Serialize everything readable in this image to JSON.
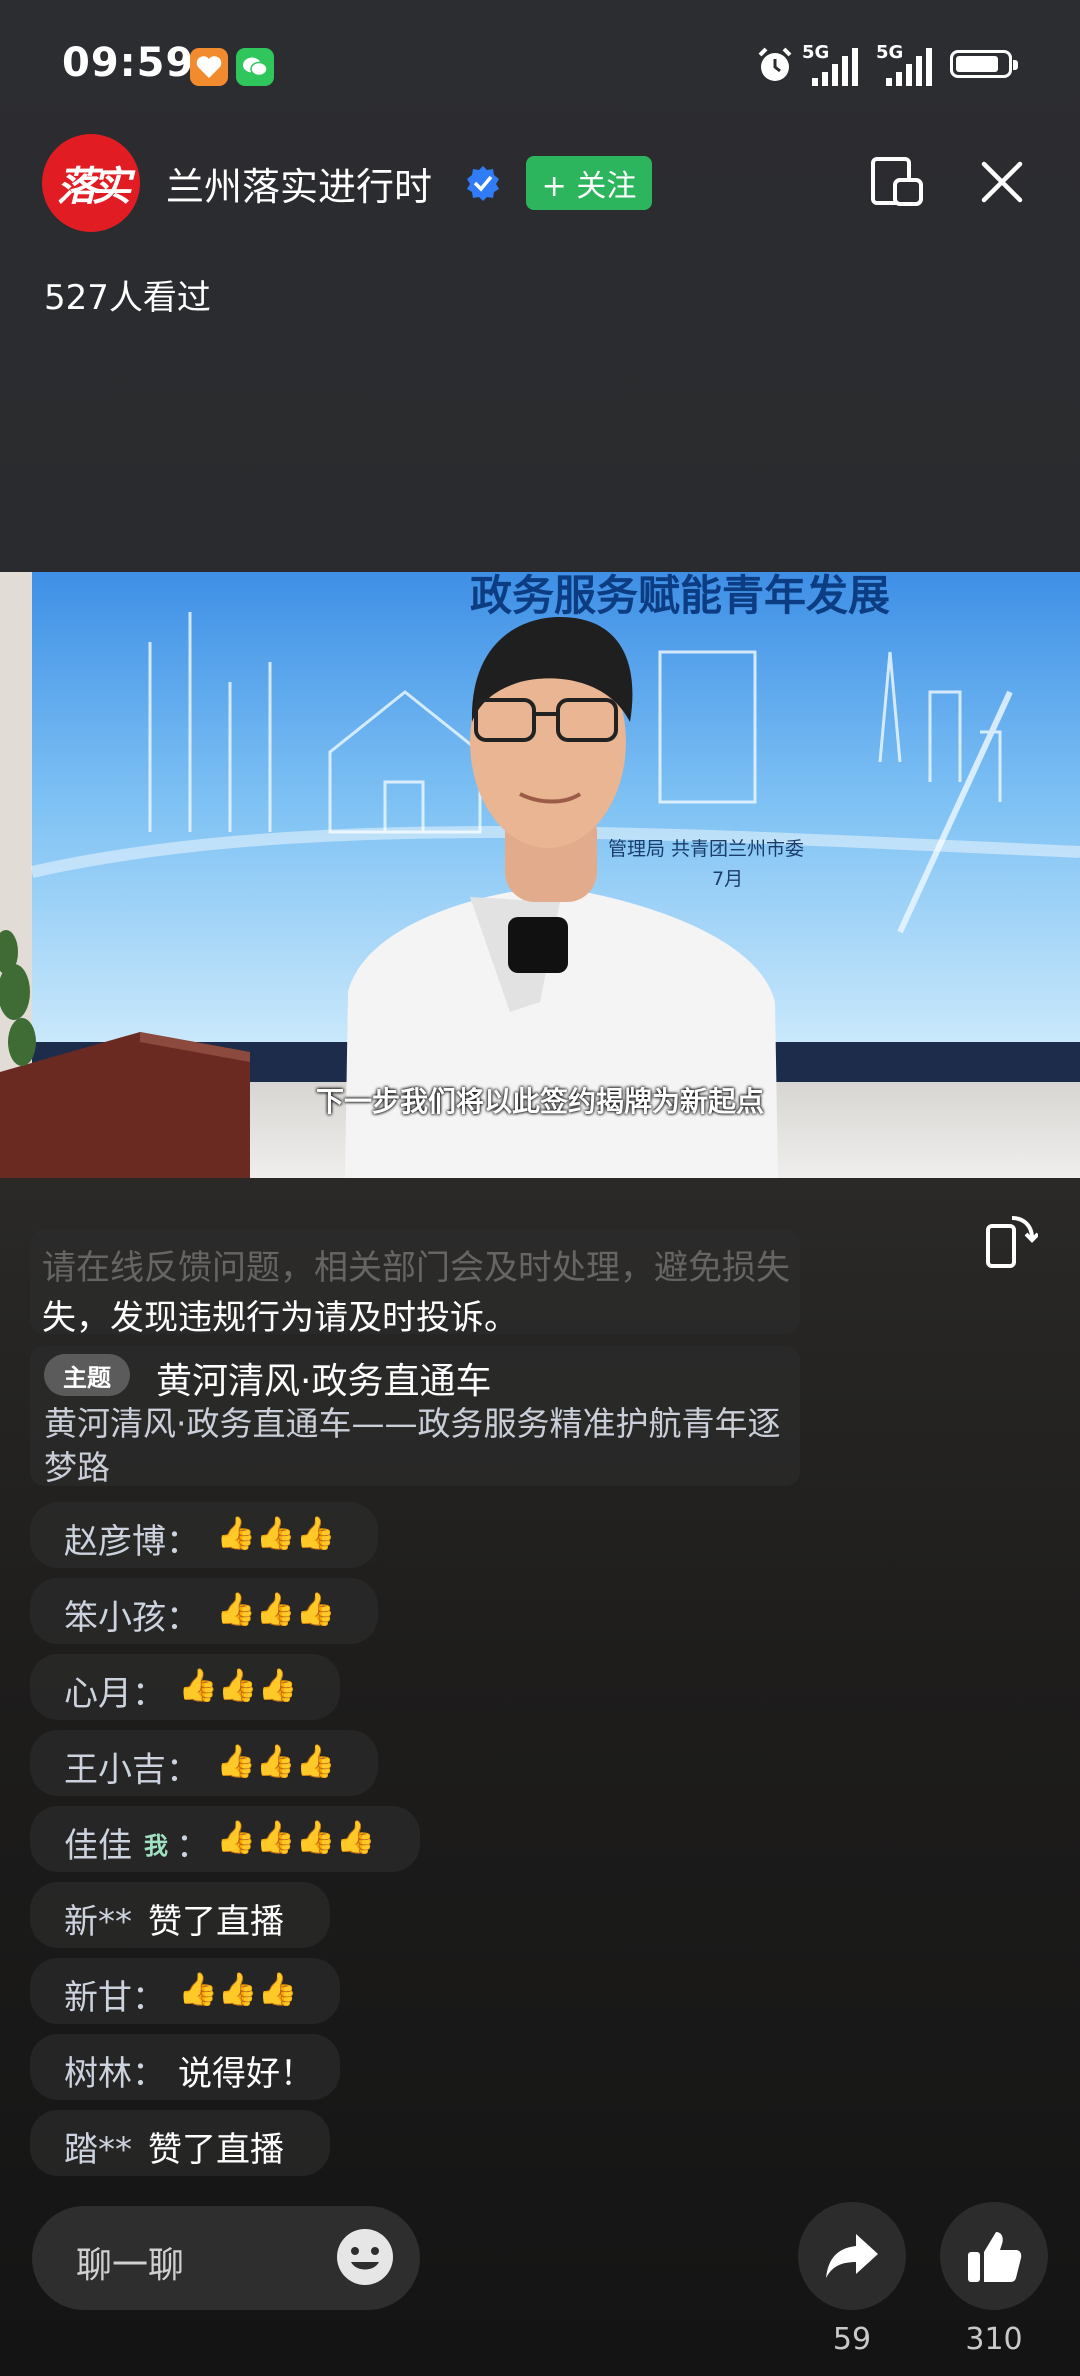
{
  "status_bar": {
    "time": "09:59",
    "network_1": "5G",
    "network_2": "5G"
  },
  "header": {
    "logo_text": "落实",
    "channel_name": "兰州落实进行时",
    "follow_label": "+ 关注",
    "viewers": "527人看过"
  },
  "video": {
    "backdrop_title": "政务服务赋能青年发展",
    "backdrop_org": "管理局   共青团兰州市委",
    "backdrop_date": "7月",
    "subtitle": "下一步我们将以此签约揭牌为新起点"
  },
  "chat": {
    "notice_clipped": "请在线反馈问题，相关部门会及时处理，避免损失",
    "notice_text": "失，发现违规行为请及时投诉。",
    "topic_tag": "主题",
    "topic_title": "黄河清风·政务直通车",
    "topic_desc": "黄河清风·政务直通车——政务服务精准护航青年逐梦路",
    "messages": [
      {
        "name": "赵彦博：",
        "text": "👍👍👍"
      },
      {
        "name": "笨小孩：",
        "text": "👍👍👍"
      },
      {
        "name": "心月：",
        "text": "👍👍👍"
      },
      {
        "name": "王小吉：",
        "text": "👍👍👍"
      },
      {
        "name": "佳佳",
        "me_tag": "我",
        "sep": "：",
        "text": "👍👍👍👍"
      },
      {
        "name": "新**",
        "text": "赞了直播"
      },
      {
        "name": "新甘：",
        "text": "👍👍👍"
      },
      {
        "name": "树林：",
        "text": "说得好！"
      },
      {
        "name": "踏**",
        "text": "赞了直播"
      }
    ]
  },
  "bottom_bar": {
    "chat_placeholder": "聊一聊",
    "share_count": "59",
    "like_count": "310"
  },
  "colors": {
    "follow_green": "#2db55d",
    "logo_red": "#e11d23",
    "verified_blue": "#2f7cf6"
  }
}
